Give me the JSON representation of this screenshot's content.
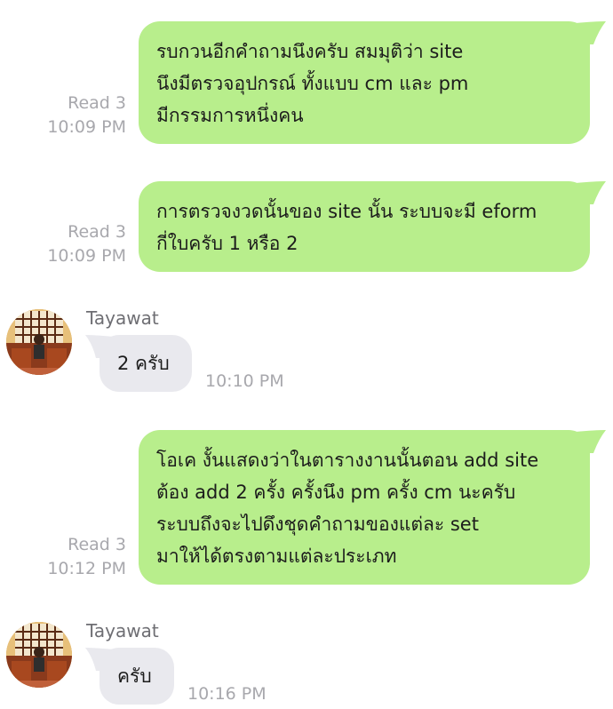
{
  "colors": {
    "outgoing_bubble": "#b8ee8c",
    "incoming_bubble": "#e9e9ee",
    "meta_text": "#a8a8ad",
    "sender_name": "#6e6e73"
  },
  "messages": [
    {
      "direction": "outgoing",
      "lines": [
        "รบกวนอีกคำถามนึงครับ สมมุติว่า site",
        "นึงมีตรวจอุปกรณ์ ทั้งแบบ cm และ pm",
        "มีกรรมการหนึ่งคน"
      ],
      "read": "Read 3",
      "time": "10:09 PM"
    },
    {
      "direction": "outgoing",
      "lines": [
        "การตรวจงวดนั้นของ site นั้น ระบบจะมี eform",
        "กี่ใบครับ 1 หรือ 2"
      ],
      "read": "Read 3",
      "time": "10:09 PM"
    },
    {
      "direction": "incoming",
      "sender": "Tayawat",
      "avatar_icon": "user-avatar-icon",
      "text": "2 ครับ",
      "time": "10:10 PM"
    },
    {
      "direction": "outgoing",
      "lines": [
        "โอเค งั้นแสดงว่าในตารางงานนั้นตอน add site",
        "ต้อง add 2 ครั้ง ครั้งนึง pm ครั้ง cm นะครับ",
        "ระบบถึงจะไปดึงชุดคำถามของแต่ละ set",
        "มาให้ได้ตรงตามแต่ละประเภท"
      ],
      "read": "Read 3",
      "time": "10:12 PM"
    },
    {
      "direction": "incoming",
      "sender": "Tayawat",
      "avatar_icon": "user-avatar-icon",
      "text": "ครับ",
      "time": "10:16 PM"
    }
  ]
}
